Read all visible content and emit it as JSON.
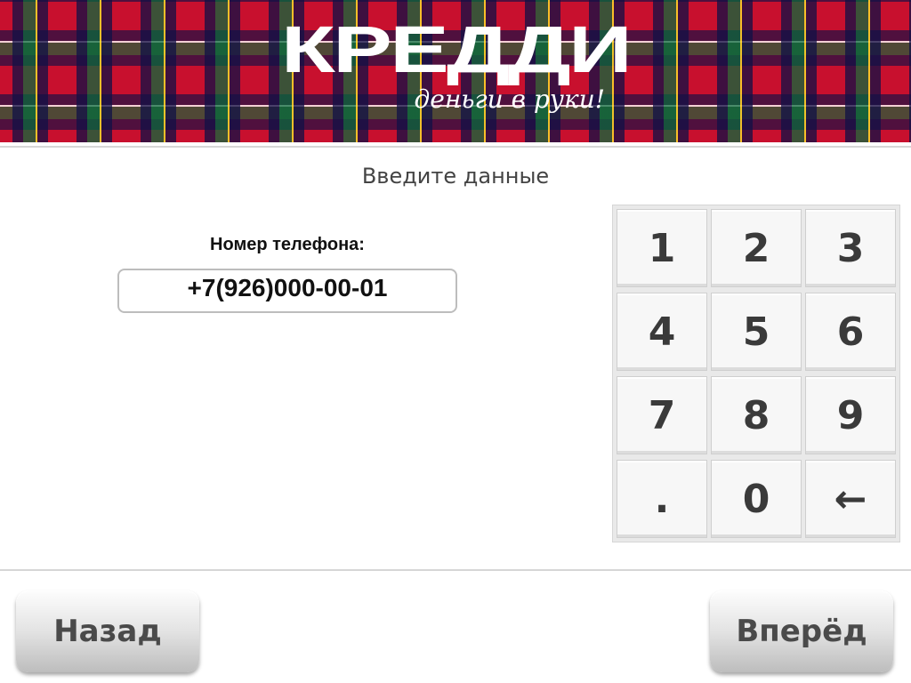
{
  "header": {
    "logo_text": "КРЕДДИ",
    "slogan": "деньги в руки!"
  },
  "prompt": "Введите данные",
  "phone": {
    "label": "Номер телефона:",
    "value": "+7(926)000-00-01"
  },
  "keypad": {
    "keys": [
      "1",
      "2",
      "3",
      "4",
      "5",
      "6",
      "7",
      "8",
      "9",
      ".",
      "0",
      "←"
    ]
  },
  "nav": {
    "back_label": "Назад",
    "next_label": "Вперёд"
  }
}
